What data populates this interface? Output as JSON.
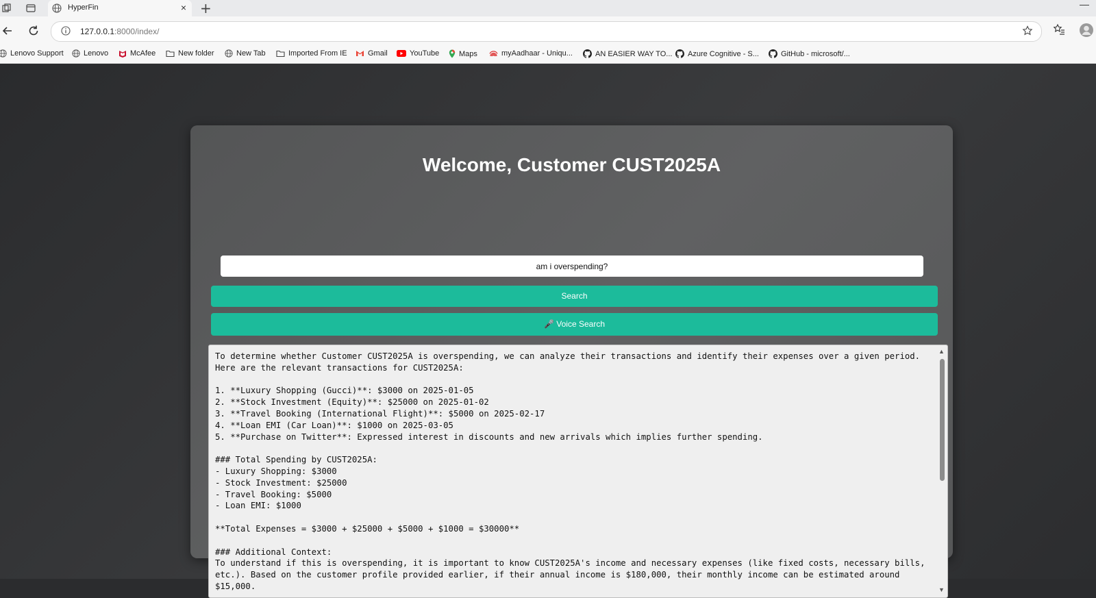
{
  "browser": {
    "tab_title": "HyperFin",
    "new_tab_symbol": "+",
    "close_symbol": "×",
    "minimize_symbol": "—",
    "address_host": "127.0.0.1",
    "address_rest": ":8000/index/",
    "bookmarks": [
      {
        "label": "Lenovo Support",
        "icon": "globe-icon"
      },
      {
        "label": "Lenovo",
        "icon": "globe-icon"
      },
      {
        "label": "McAfee",
        "icon": "mcafee-icon"
      },
      {
        "label": "New folder",
        "icon": "folder-icon"
      },
      {
        "label": "New Tab",
        "icon": "globe-icon"
      },
      {
        "label": "Imported From IE",
        "icon": "folder-icon"
      },
      {
        "label": "Gmail",
        "icon": "gmail-icon"
      },
      {
        "label": "YouTube",
        "icon": "youtube-icon"
      },
      {
        "label": "Maps",
        "icon": "maps-icon"
      },
      {
        "label": "myAadhaar - Uniqu...",
        "icon": "aadhaar-icon"
      },
      {
        "label": "AN EASIER WAY TO...",
        "icon": "github-icon"
      },
      {
        "label": "Azure Cognitive - S...",
        "icon": "github-icon"
      },
      {
        "label": "GitHub - microsoft/...",
        "icon": "github-icon"
      }
    ]
  },
  "page": {
    "title": "Welcome, Customer CUST2025A",
    "query_value": "am i overspending?",
    "search_label": "Search",
    "voice_label": "🎤 Voice Search",
    "result_text": "To determine whether Customer CUST2025A is overspending, we can analyze their transactions and identify their expenses over a given period. Here are the relevant transactions for CUST2025A:\n\n1. **Luxury Shopping (Gucci)**: $3000 on 2025-01-05\n2. **Stock Investment (Equity)**: $25000 on 2025-01-02\n3. **Travel Booking (International Flight)**: $5000 on 2025-02-17\n4. **Loan EMI (Car Loan)**: $1000 on 2025-03-05\n5. **Purchase on Twitter**: Expressed interest in discounts and new arrivals which implies further spending.\n\n### Total Spending by CUST2025A:\n- Luxury Shopping: $3000\n- Stock Investment: $25000\n- Travel Booking: $5000\n- Loan EMI: $1000\n\n**Total Expenses = $3000 + $25000 + $5000 + $1000 = $30000**\n\n### Additional Context:\nTo understand if this is overspending, it is important to know CUST2025A's income and necessary expenses (like fixed costs, necessary bills, etc.). Based on the customer profile provided earlier, if their annual income is $180,000, their monthly income can be estimated around $15,000."
  },
  "colors": {
    "accent_button": "#1cbb9b",
    "card_bg": "#5c5d5e",
    "page_bg": "#2b2c2e"
  }
}
